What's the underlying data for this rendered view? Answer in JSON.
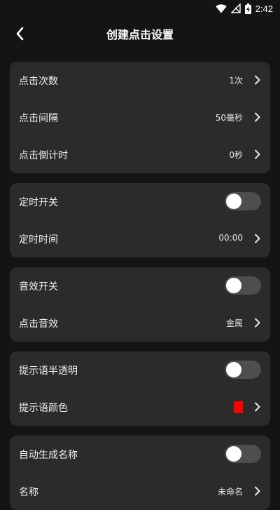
{
  "status_bar": {
    "time": "2:42",
    "icons": [
      "wifi-icon",
      "signal-off-icon",
      "battery-charging-icon"
    ]
  },
  "header": {
    "title": "创建点击设置",
    "back_icon": "chevron-left-icon"
  },
  "groups": {
    "click": {
      "count_label": "点击次数",
      "count_value": "1次",
      "interval_label": "点击间隔",
      "interval_value": "50毫秒",
      "countdown_label": "点击倒计时",
      "countdown_value": "0秒"
    },
    "timer": {
      "switch_label": "定时开关",
      "switch_on": false,
      "time_label": "定时时间",
      "time_value": "00:00"
    },
    "sound": {
      "switch_label": "音效开关",
      "switch_on": false,
      "sound_label": "点击音效",
      "sound_value": "金属"
    },
    "hint": {
      "transparent_label": "提示语半透明",
      "transparent_on": false,
      "color_label": "提示语颜色",
      "color_value": "#ff0000"
    },
    "name": {
      "auto_label": "自动生成名称",
      "auto_on": false,
      "name_label": "名称",
      "name_value": "未命名"
    }
  },
  "colors": {
    "background": "#141414",
    "card": "#2b2b2b",
    "toggle_off_track": "#4e4e4e",
    "toggle_knob": "#ffffff"
  }
}
